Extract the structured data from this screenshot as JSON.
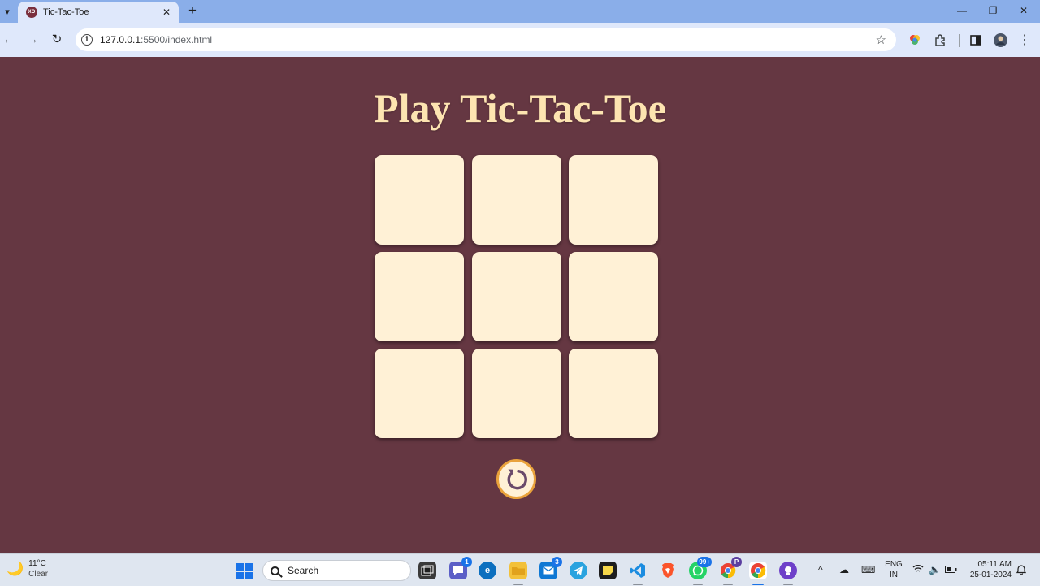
{
  "browser": {
    "tab_title": "Tic-Tac-Toe",
    "tab_favicon_text": "XO",
    "url_host": "127.0.0.1",
    "url_rest": ":5500/index.html"
  },
  "game": {
    "title": "Play Tic-Tac-Toe",
    "cells": [
      "",
      "",
      "",
      "",
      "",
      "",
      "",
      "",
      ""
    ],
    "colors": {
      "page_bg": "#653742",
      "title": "#fde4b1",
      "cell": "#fff1d6",
      "reset_border": "#e9a23b",
      "reset_icon": "#6a4a6b"
    }
  },
  "taskbar": {
    "weather_temp": "11°C",
    "weather_desc": "Clear",
    "search_placeholder": "Search",
    "badges": {
      "teams": "1",
      "mail": "3",
      "whatsapp": "99+",
      "profile": "P"
    },
    "lang_1": "ENG",
    "lang_2": "IN",
    "time": "05:11 AM",
    "date": "25-01-2024"
  }
}
